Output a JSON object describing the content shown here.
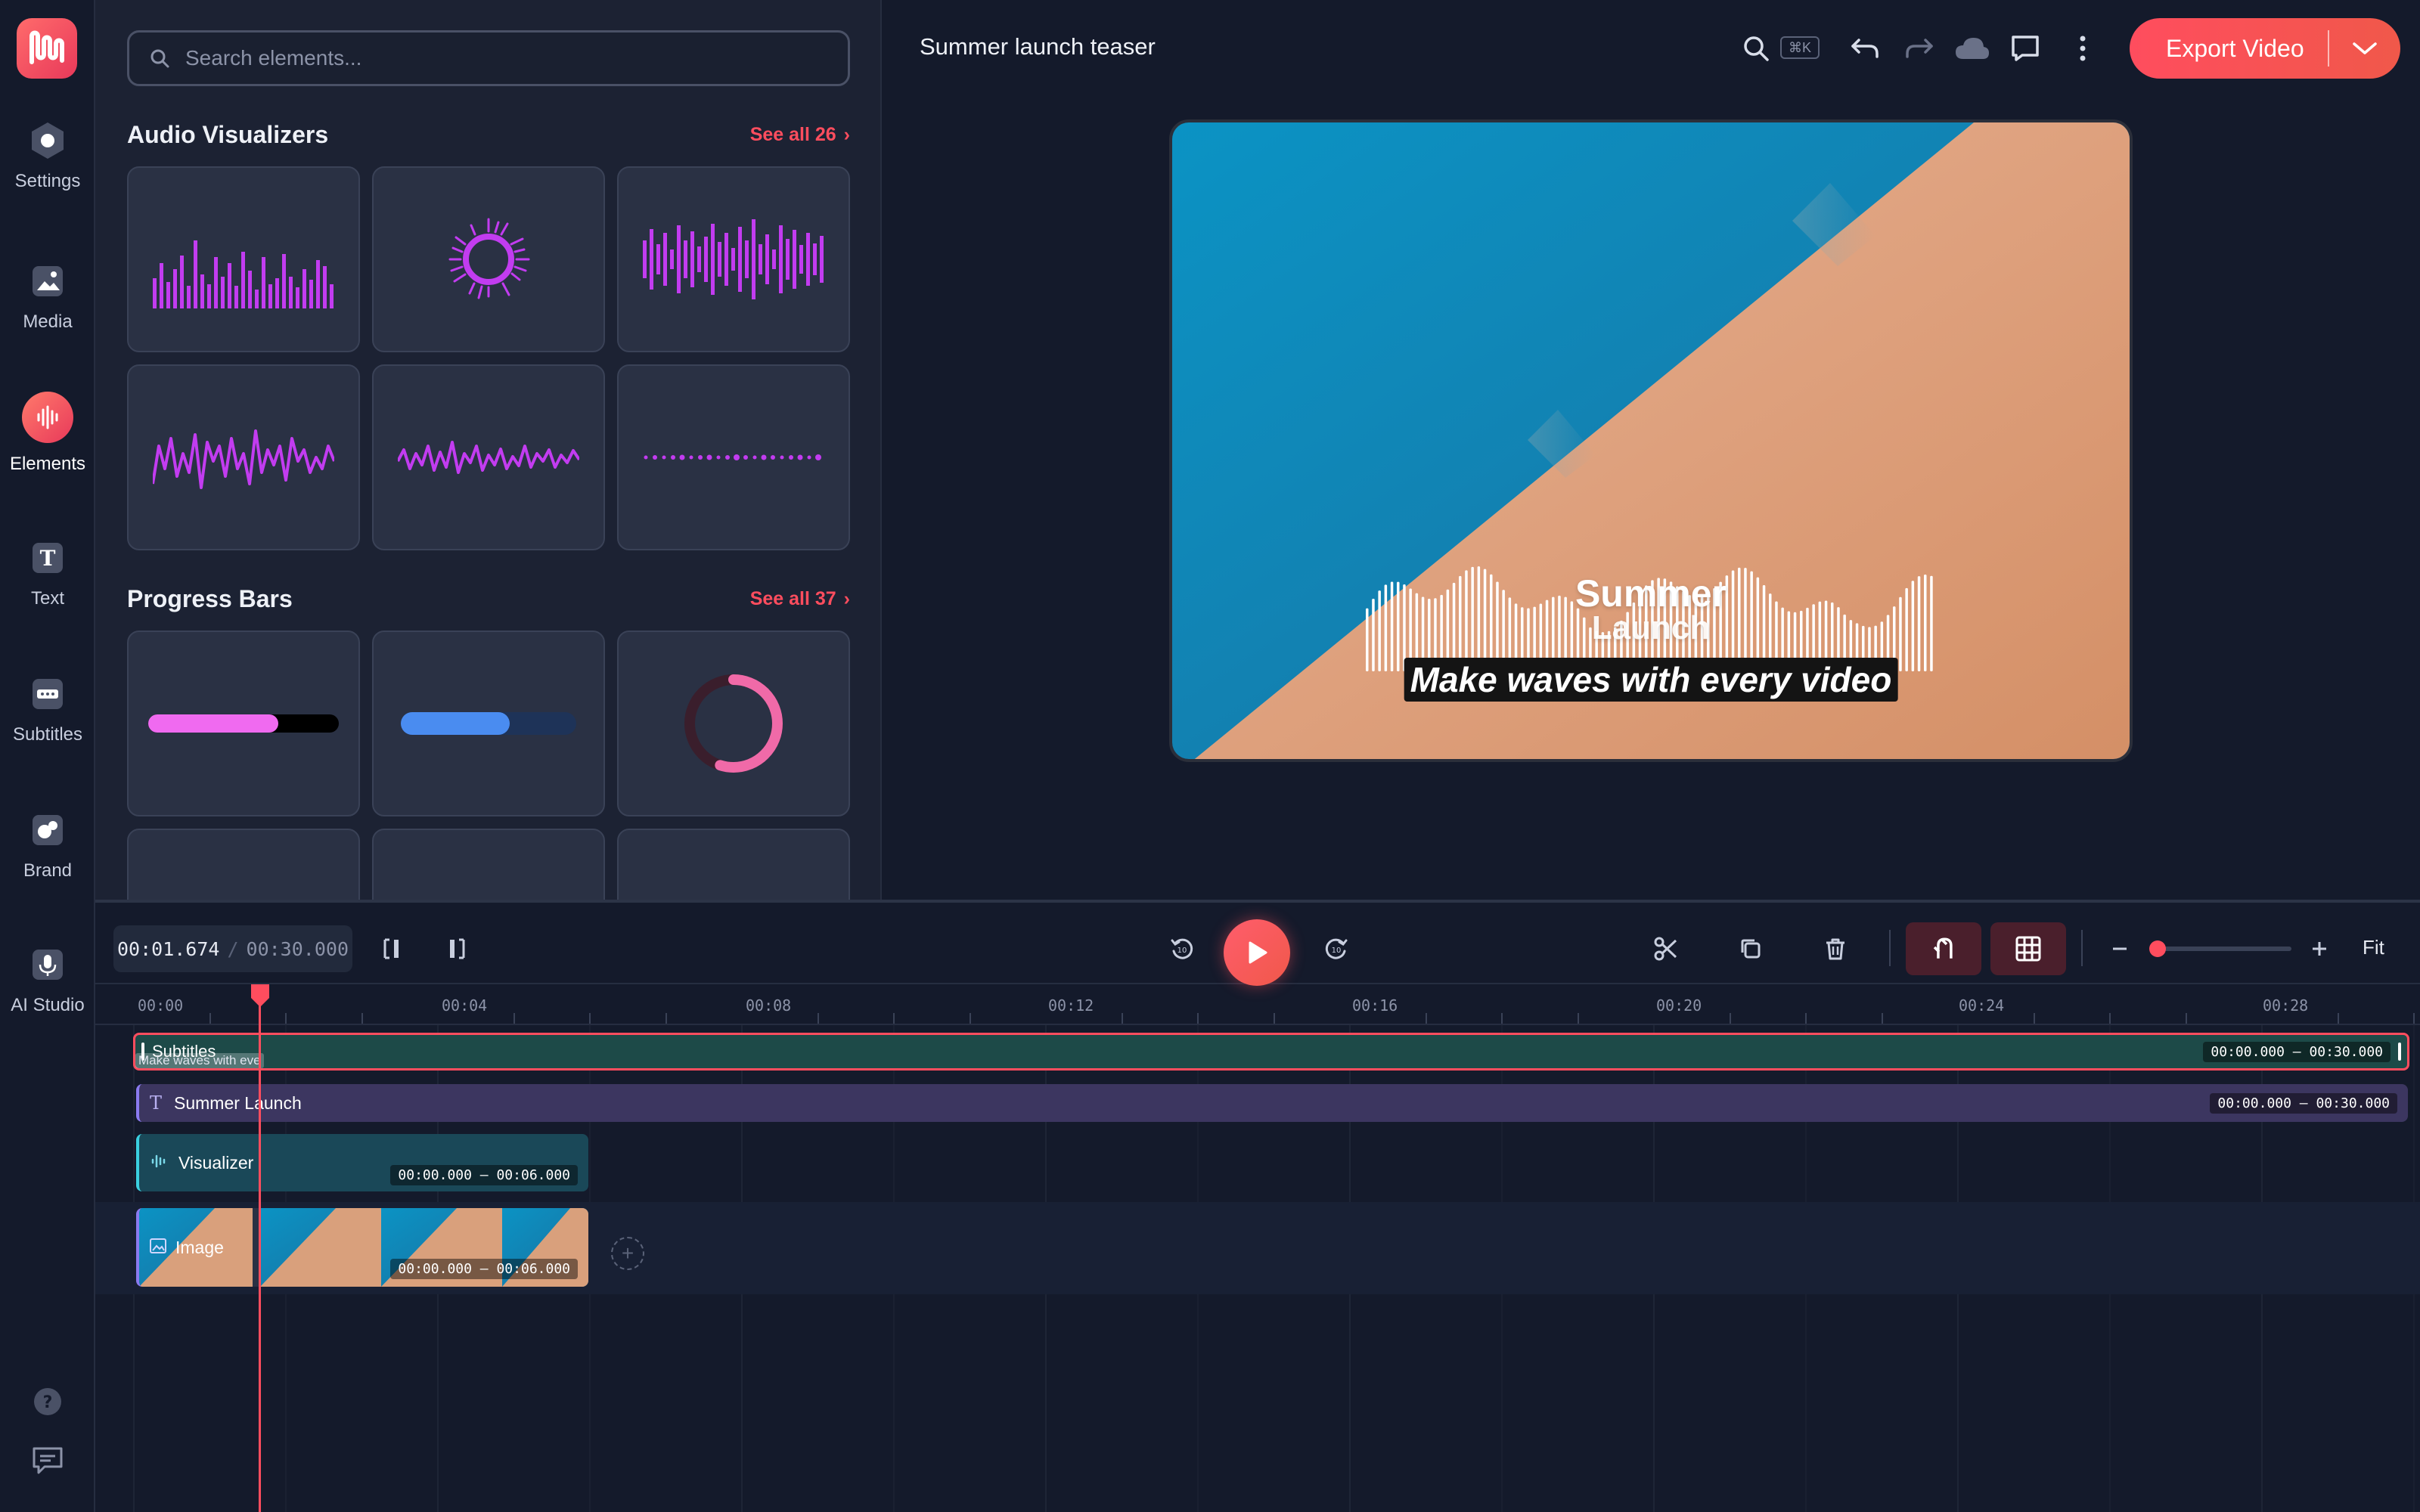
{
  "rail": {
    "items": [
      {
        "label": "Settings",
        "icon": "hexagon-icon"
      },
      {
        "label": "Media",
        "icon": "image-icon"
      },
      {
        "label": "Elements",
        "icon": "waveform-icon",
        "active": true
      },
      {
        "label": "Text",
        "icon": "text-t-icon"
      },
      {
        "label": "Subtitles",
        "icon": "subtitles-icon"
      },
      {
        "label": "Brand",
        "icon": "brand-icon"
      },
      {
        "label": "AI Studio",
        "icon": "microphone-icon"
      }
    ]
  },
  "panel": {
    "search_placeholder": "Search elements...",
    "sections": [
      {
        "title": "Audio Visualizers",
        "see_all": "See all 26"
      },
      {
        "title": "Progress Bars",
        "see_all": "See all 37"
      }
    ]
  },
  "topbar": {
    "project_title": "Summer launch teaser",
    "shortcut": "⌘K",
    "export_label": "Export Video"
  },
  "preview": {
    "title_line1": "Summer",
    "title_line2": "Launch",
    "caption": "Make waves with every video"
  },
  "timeline": {
    "current_time": "00:01.674",
    "separator": "/",
    "total_time": "00:30.000",
    "fit_label": "Fit",
    "ruler_labels": [
      "00:00",
      "00:04",
      "00:08",
      "00:12",
      "00:16",
      "00:20",
      "00:24",
      "00:28"
    ],
    "tracks": [
      {
        "name": "Subtitles",
        "range": "00:00.000 – 00:30.000",
        "snippet": "Make waves with eve"
      },
      {
        "name": "Summer Launch",
        "range": "00:00.000 – 00:30.000"
      },
      {
        "name": "Visualizer",
        "range": "00:00.000 – 00:06.000"
      },
      {
        "name": "Image",
        "range": "00:00.000 – 00:06.000"
      }
    ]
  },
  "colors": {
    "accent": "#ff4d5e",
    "visualizer": "#c23cf0",
    "panel_bg": "#1c2233",
    "app_bg": "#141a2b"
  }
}
